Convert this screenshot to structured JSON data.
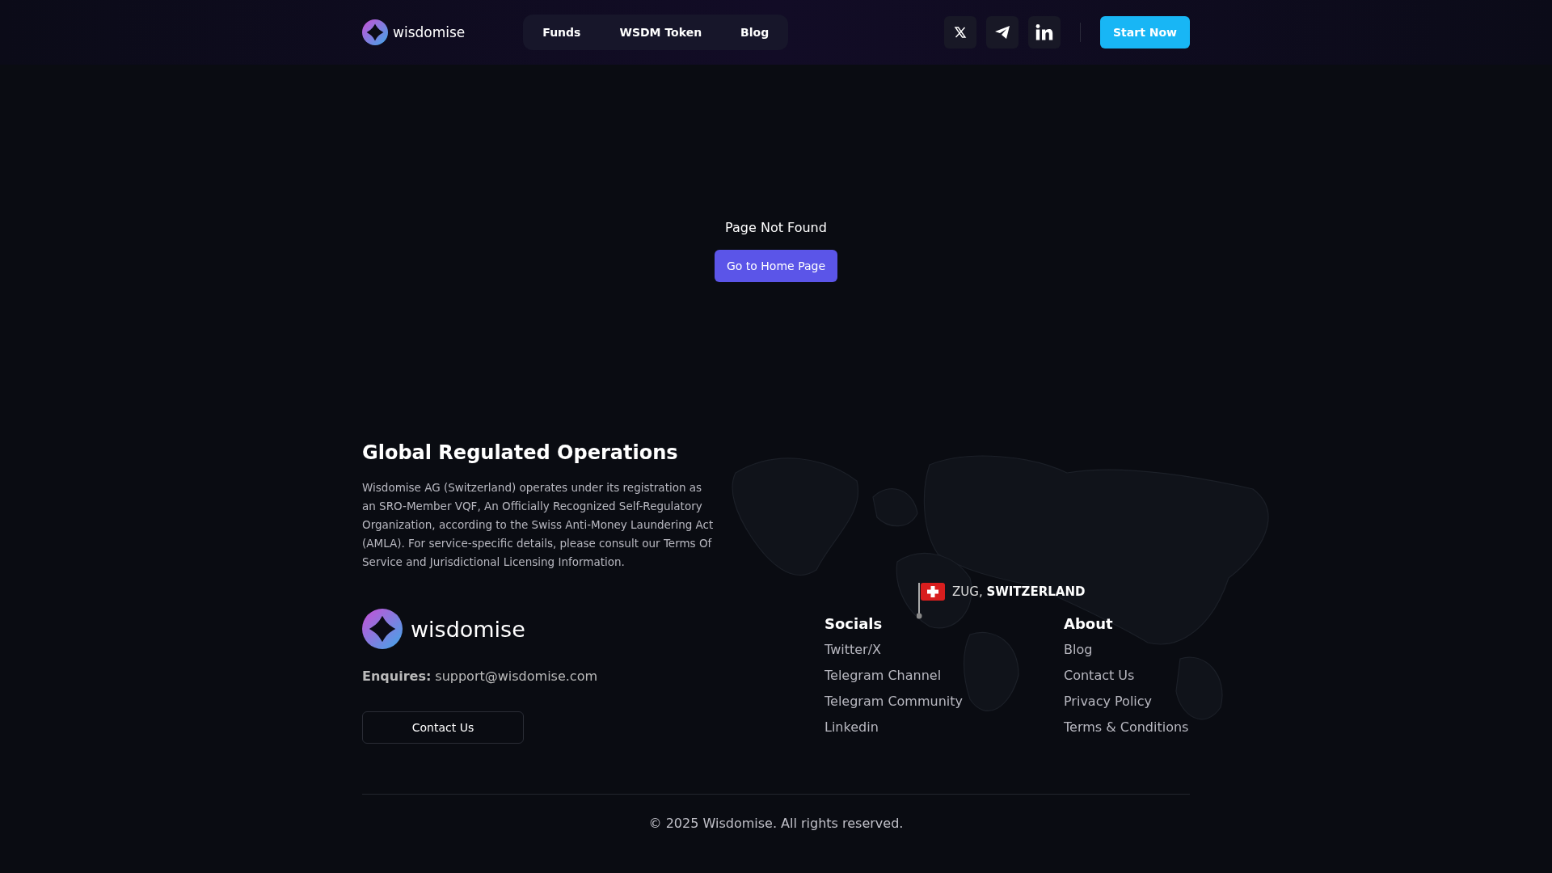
{
  "header": {
    "brand": "wisdomise",
    "nav": [
      {
        "label": "Funds"
      },
      {
        "label": "WSDM Token"
      },
      {
        "label": "Blog"
      }
    ],
    "socials": [
      {
        "kind": "x"
      },
      {
        "kind": "telegram"
      },
      {
        "kind": "linkedin"
      }
    ],
    "cta": "Start Now"
  },
  "not_found": {
    "message": "Page Not Found",
    "button": "Go to Home Page"
  },
  "footer": {
    "title": "Global Regulated Operations",
    "description": "Wisdomise AG (Switzerland) operates under its registration as an SRO-Member VQF, An Officially Recognized Self-Regulatory Organization, according to the Swiss Anti-Money Laundering Act (AMLA). For service-specific details, please consult our Terms Of Service and Jurisdictional Licensing Information.",
    "location": "ZUG, **SWITZERLAND**",
    "brand": "wisdomise",
    "enquiries_label": "Enquires:",
    "email": "support@wisdomise.com",
    "contact_button": "Contact Us",
    "columns": [
      {
        "heading": "Socials",
        "links": [
          "Twitter/X",
          "Telegram Channel",
          "Telegram Community",
          "Linkedin"
        ]
      },
      {
        "heading": "About",
        "links": [
          "Blog",
          "Contact Us",
          "Privacy Policy",
          "Terms & Conditions"
        ]
      }
    ],
    "copyright": "© 2025 Wisdomise. All rights reserved."
  }
}
